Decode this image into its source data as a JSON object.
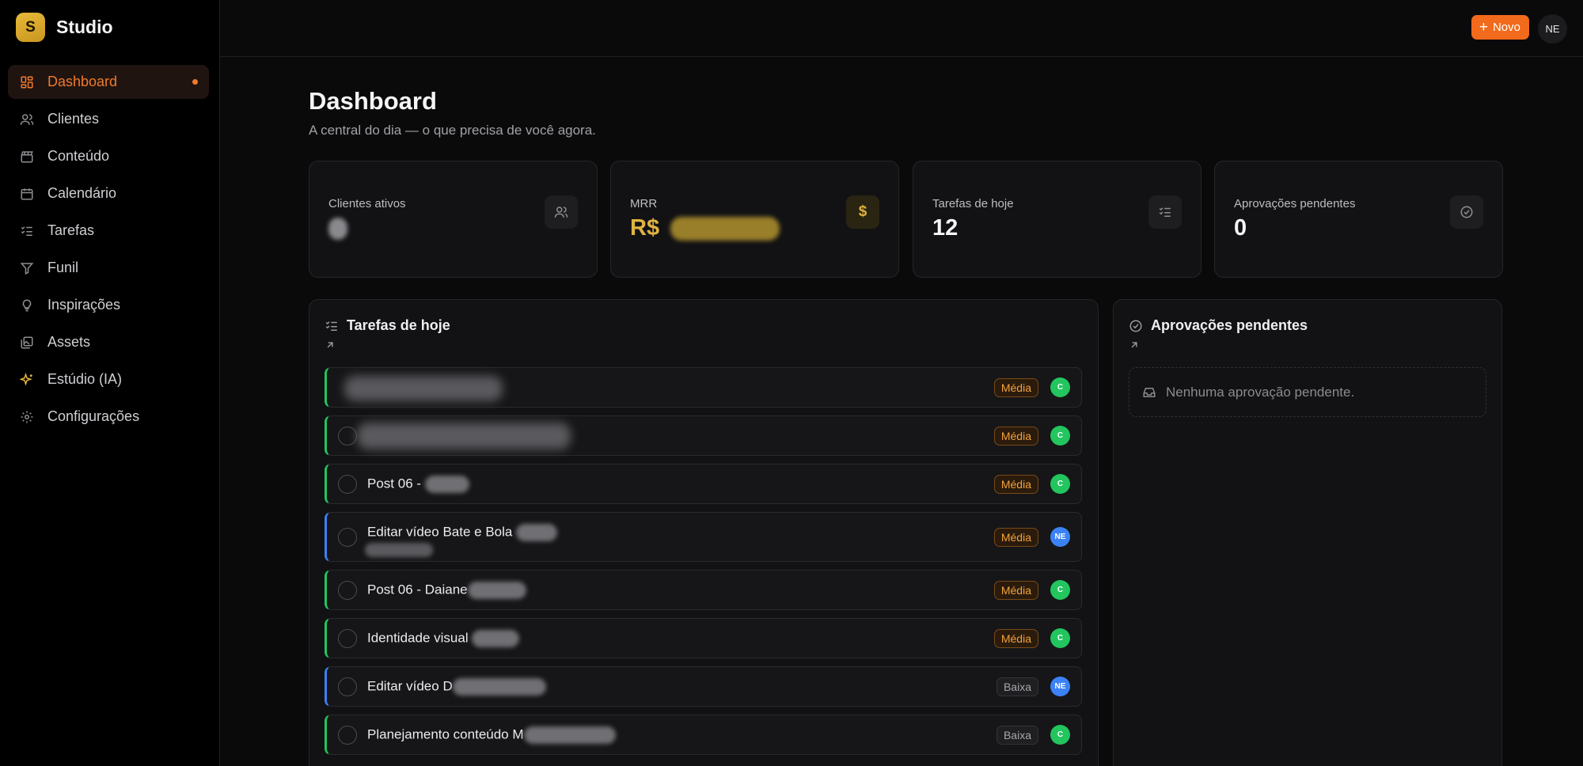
{
  "app": {
    "logo_letter": "S",
    "name": "Studio"
  },
  "sidebar": {
    "items": [
      {
        "label": "Dashboard",
        "icon": "grid-icon"
      },
      {
        "label": "Clientes",
        "icon": "users-icon"
      },
      {
        "label": "Conteúdo",
        "icon": "clapperboard-icon"
      },
      {
        "label": "Calendário",
        "icon": "calendar-icon"
      },
      {
        "label": "Tarefas",
        "icon": "checklist-icon"
      },
      {
        "label": "Funil",
        "icon": "funnel-icon"
      },
      {
        "label": "Inspirações",
        "icon": "lightbulb-icon"
      },
      {
        "label": "Assets",
        "icon": "images-icon"
      },
      {
        "label": "Estúdio (IA)",
        "icon": "sparkles-icon"
      },
      {
        "label": "Configurações",
        "icon": "gear-icon"
      }
    ]
  },
  "topbar": {
    "new_label": "Novo",
    "user_initials": "NE"
  },
  "page": {
    "title": "Dashboard",
    "subtitle": "A central do dia — o que precisa de você agora."
  },
  "stats": [
    {
      "label": "Clientes ativos",
      "value": "",
      "icon": "users-icon"
    },
    {
      "label": "MRR",
      "value": "R$",
      "icon": "dollar-icon"
    },
    {
      "label": "Tarefas de hoje",
      "value": "12",
      "icon": "checklist-icon"
    },
    {
      "label": "Aprovações pendentes",
      "value": "0",
      "icon": "check-circle-icon"
    }
  ],
  "tasks_panel": {
    "title": "Tarefas de hoje",
    "tasks": [
      {
        "title": "",
        "priority": "Média",
        "assignee": "C"
      },
      {
        "title": "",
        "priority": "Média",
        "assignee": "C"
      },
      {
        "title": "Post 06 - ",
        "priority": "Média",
        "assignee": "C"
      },
      {
        "title": "Editar vídeo Bate e Bola ",
        "priority": "Média",
        "assignee": "NE"
      },
      {
        "title": "Post 06 - Daiane",
        "priority": "Média",
        "assignee": "C"
      },
      {
        "title": "Identidade visual ",
        "priority": "Média",
        "assignee": "C"
      },
      {
        "title": "Editar vídeo D",
        "priority": "Baixa",
        "assignee": "NE"
      },
      {
        "title": "Planejamento conteúdo M",
        "priority": "Baixa",
        "assignee": "C"
      }
    ]
  },
  "approvals_panel": {
    "title": "Aprovações pendentes",
    "empty_text": "Nenhuma aprovação pendente."
  },
  "colors": {
    "accent": "#f26a1b",
    "gold": "#e0b341",
    "green": "#22c55e",
    "blue": "#3b82f6"
  }
}
